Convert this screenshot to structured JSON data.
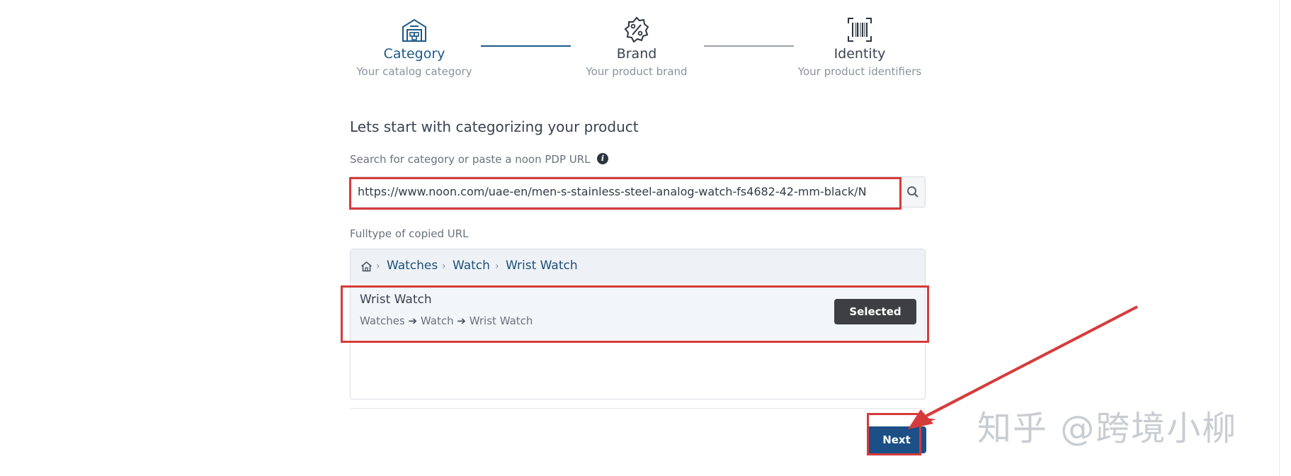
{
  "steps": [
    {
      "title": "Category",
      "subtitle": "Your catalog category",
      "icon": "warehouse-icon"
    },
    {
      "title": "Brand",
      "subtitle": "Your product brand",
      "icon": "badge-percent-icon"
    },
    {
      "title": "Identity",
      "subtitle": "Your product identifiers",
      "icon": "barcode-scan-icon"
    }
  ],
  "main": {
    "heading": "Lets start with categorizing your product",
    "search_label": "Search for category or paste a noon PDP URL",
    "search_value": "https://www.noon.com/uae-en/men-s-stainless-steel-analog-watch-fs4682-42-mm-black/N",
    "fulltype_label": "Fulltype of copied URL",
    "breadcrumb": [
      "Watches",
      "Watch",
      "Wrist Watch"
    ],
    "result": {
      "title": "Wrist Watch",
      "path": [
        "Watches",
        "Watch",
        "Wrist Watch"
      ],
      "button": "Selected"
    },
    "next_label": "Next"
  },
  "watermark": "知乎 @跨境小柳",
  "colors": {
    "accent": "#1c5a8a",
    "next_button": "#1b4f86",
    "selected_button": "#3d3f42",
    "highlight": "#d63b3b"
  }
}
